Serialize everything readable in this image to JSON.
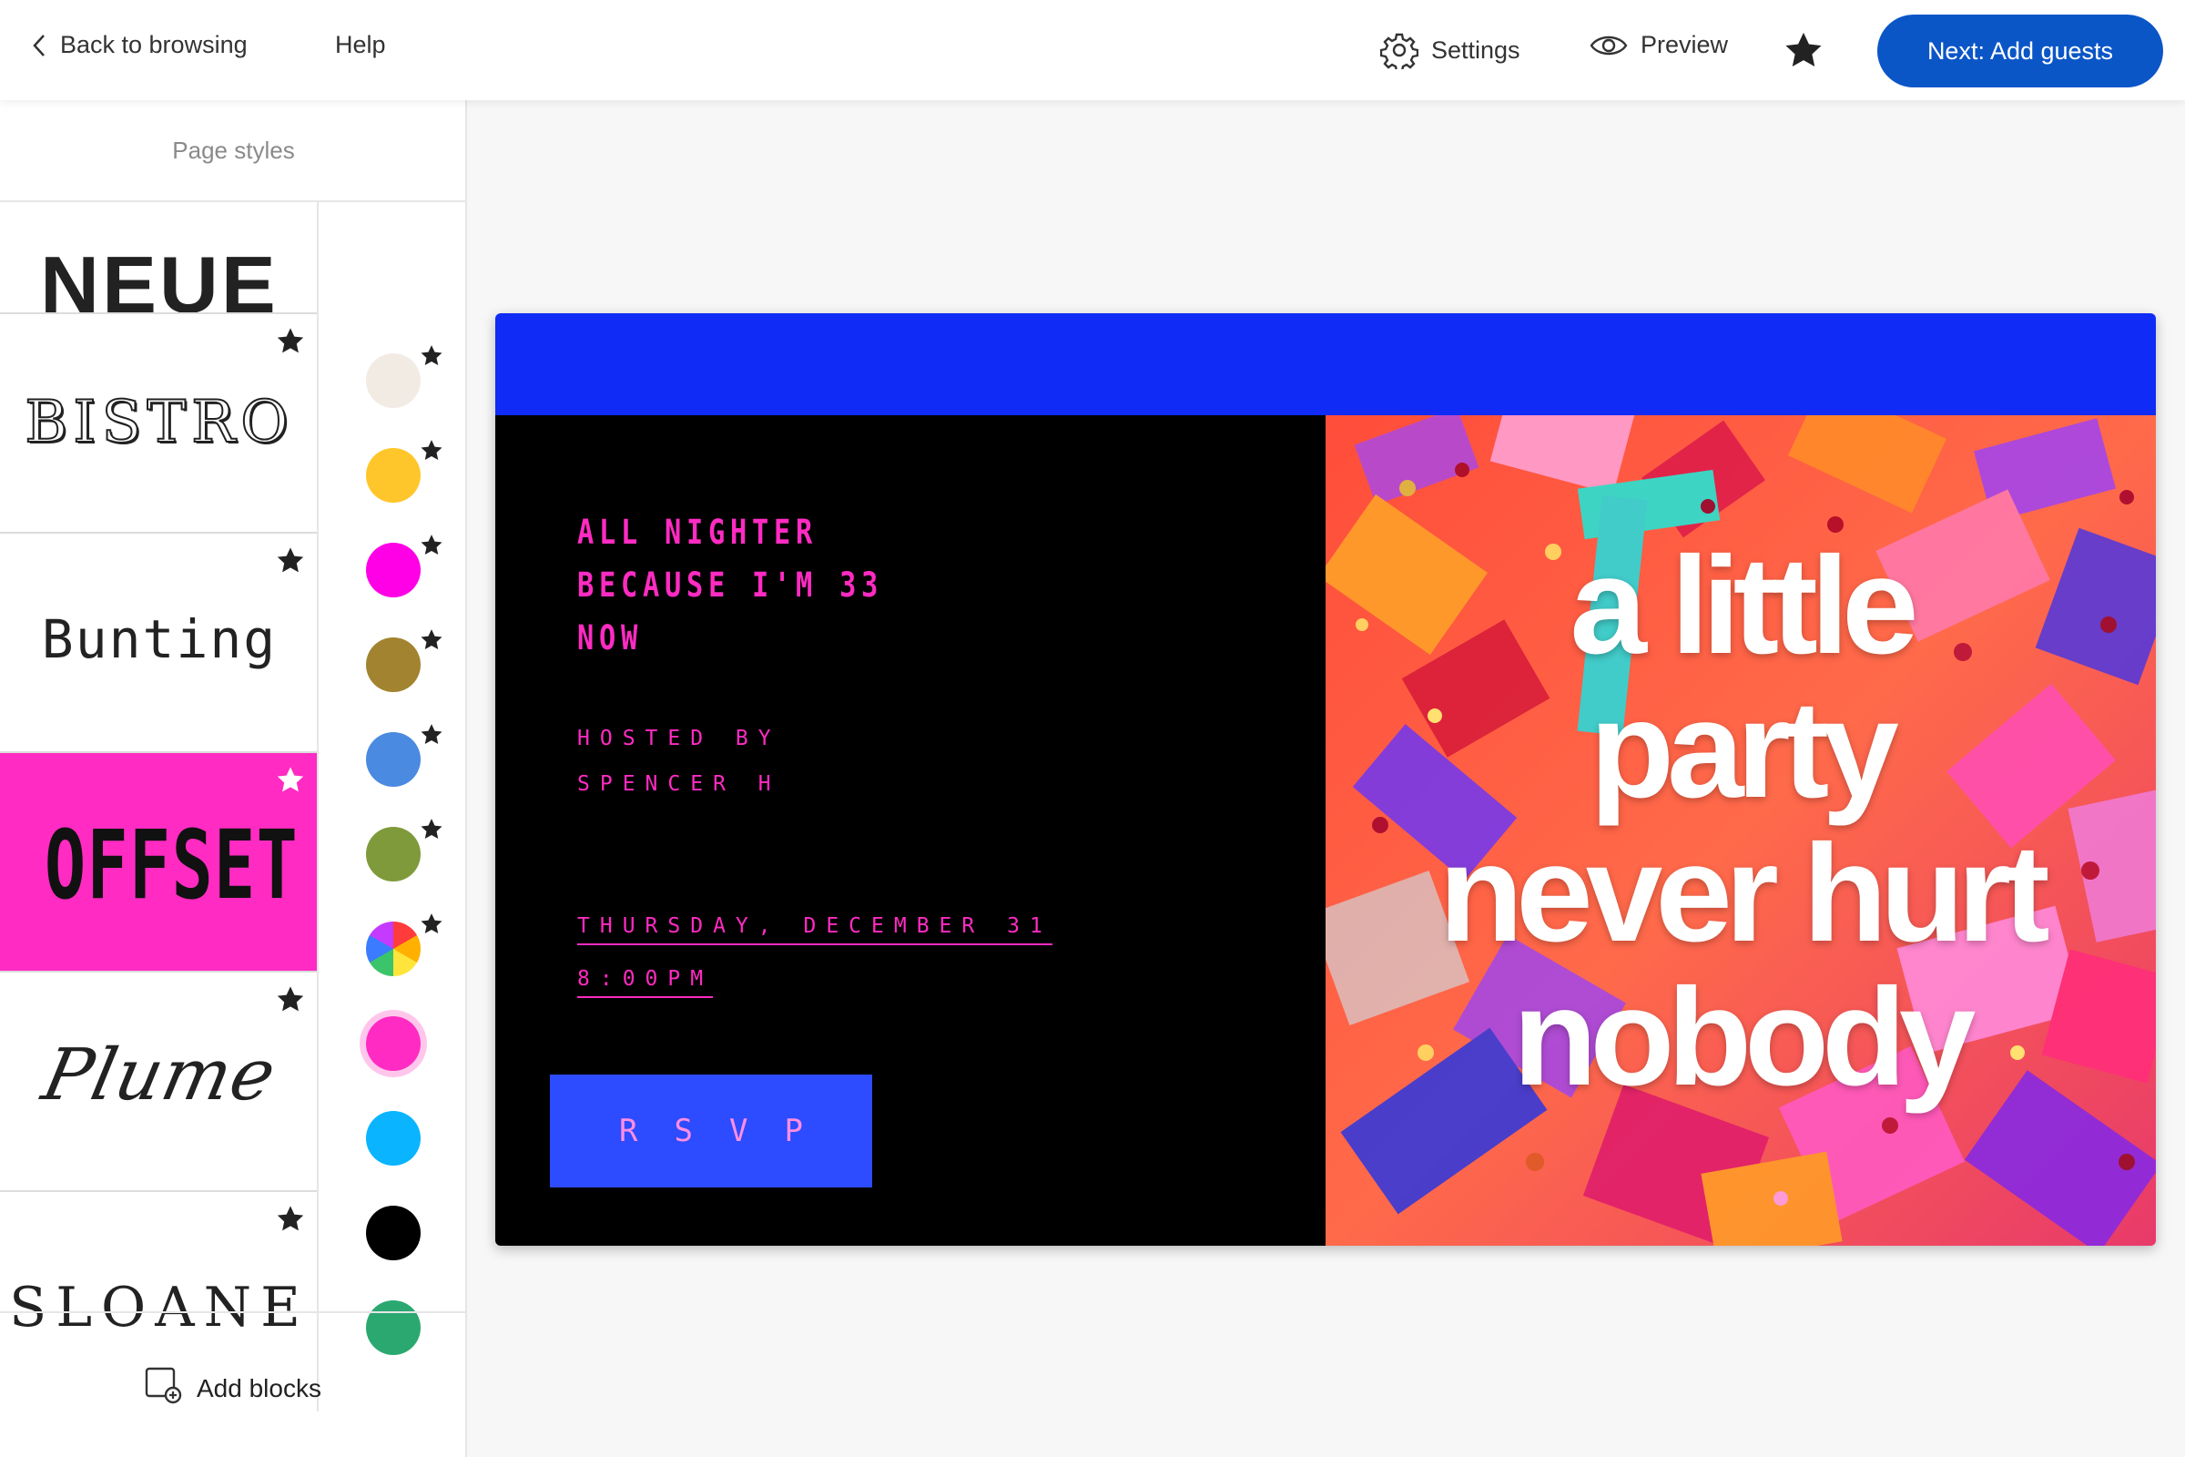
{
  "topbar": {
    "back_label": "Back to browsing",
    "help_label": "Help",
    "settings_label": "Settings",
    "preview_label": "Preview",
    "next_label": "Next: Add guests",
    "accent": "#0b56c7"
  },
  "sidebar": {
    "title": "Page styles",
    "fonts": [
      {
        "name": "NEUE",
        "favorite": false
      },
      {
        "name": "BISTRO",
        "favorite": true
      },
      {
        "name": "Bunting",
        "favorite": true
      },
      {
        "name": "OFFSET",
        "favorite": true,
        "selected": true
      },
      {
        "name": "Plume",
        "favorite": true
      },
      {
        "name": "SLOANE",
        "favorite": true
      }
    ],
    "colors": [
      {
        "hex": "#f2ebe4",
        "favorite": true
      },
      {
        "hex": "#ffc62b",
        "favorite": true
      },
      {
        "hex": "#ff00e6",
        "favorite": true
      },
      {
        "hex": "#a2832f",
        "favorite": true
      },
      {
        "hex": "#4a8ae0",
        "favorite": true
      },
      {
        "hex": "#7f9a3a",
        "favorite": true
      },
      {
        "hex": "multicolor",
        "favorite": true
      },
      {
        "hex": "#ff2bc2",
        "favorite": false,
        "selected": true
      },
      {
        "hex": "#0ab4ff",
        "favorite": false
      },
      {
        "hex": "#000000",
        "favorite": false
      },
      {
        "hex": "#2aa870",
        "favorite": false
      }
    ],
    "add_blocks_label": "Add blocks"
  },
  "invite": {
    "headline_lines": [
      "ALL NIGHTER",
      "BECAUSE I'M 33",
      "NOW"
    ],
    "hosted_lines": [
      "HOSTED BY",
      "SPENCER H"
    ],
    "date": "THURSDAY, DECEMBER 31",
    "time": "8:00PM",
    "rsvp_label": "RSVP",
    "image_text_lines": [
      "a little",
      "party",
      "never hurt",
      "nobody"
    ],
    "colors": {
      "header": "#0f2bf5",
      "text": "#ff2bc2",
      "button": "#2d4bff"
    }
  }
}
